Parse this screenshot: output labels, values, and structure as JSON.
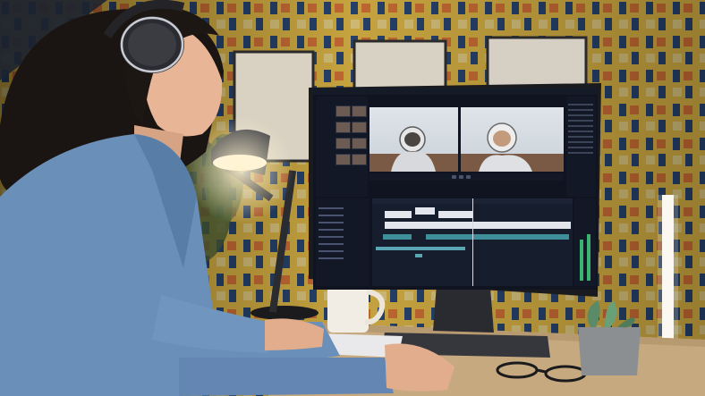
{
  "scene": {
    "description_tokens": [],
    "colors": {
      "wall_yellow": "#e9c04a",
      "wall_blue": "#2b4a7a",
      "wall_orange": "#e0783a",
      "shirt_blue": "#6a8fb8",
      "desk": "#c7a97f",
      "monitor_bezel": "#1a1b1f",
      "screen_bg": "#0f1420",
      "timeline_clip": "#e4e6ee",
      "audio_clip": "#3f8f9a",
      "meter_green": "#39b36f"
    }
  },
  "monitor_ui": {
    "topbar_items": [
      "",
      "",
      ""
    ],
    "note": ""
  }
}
